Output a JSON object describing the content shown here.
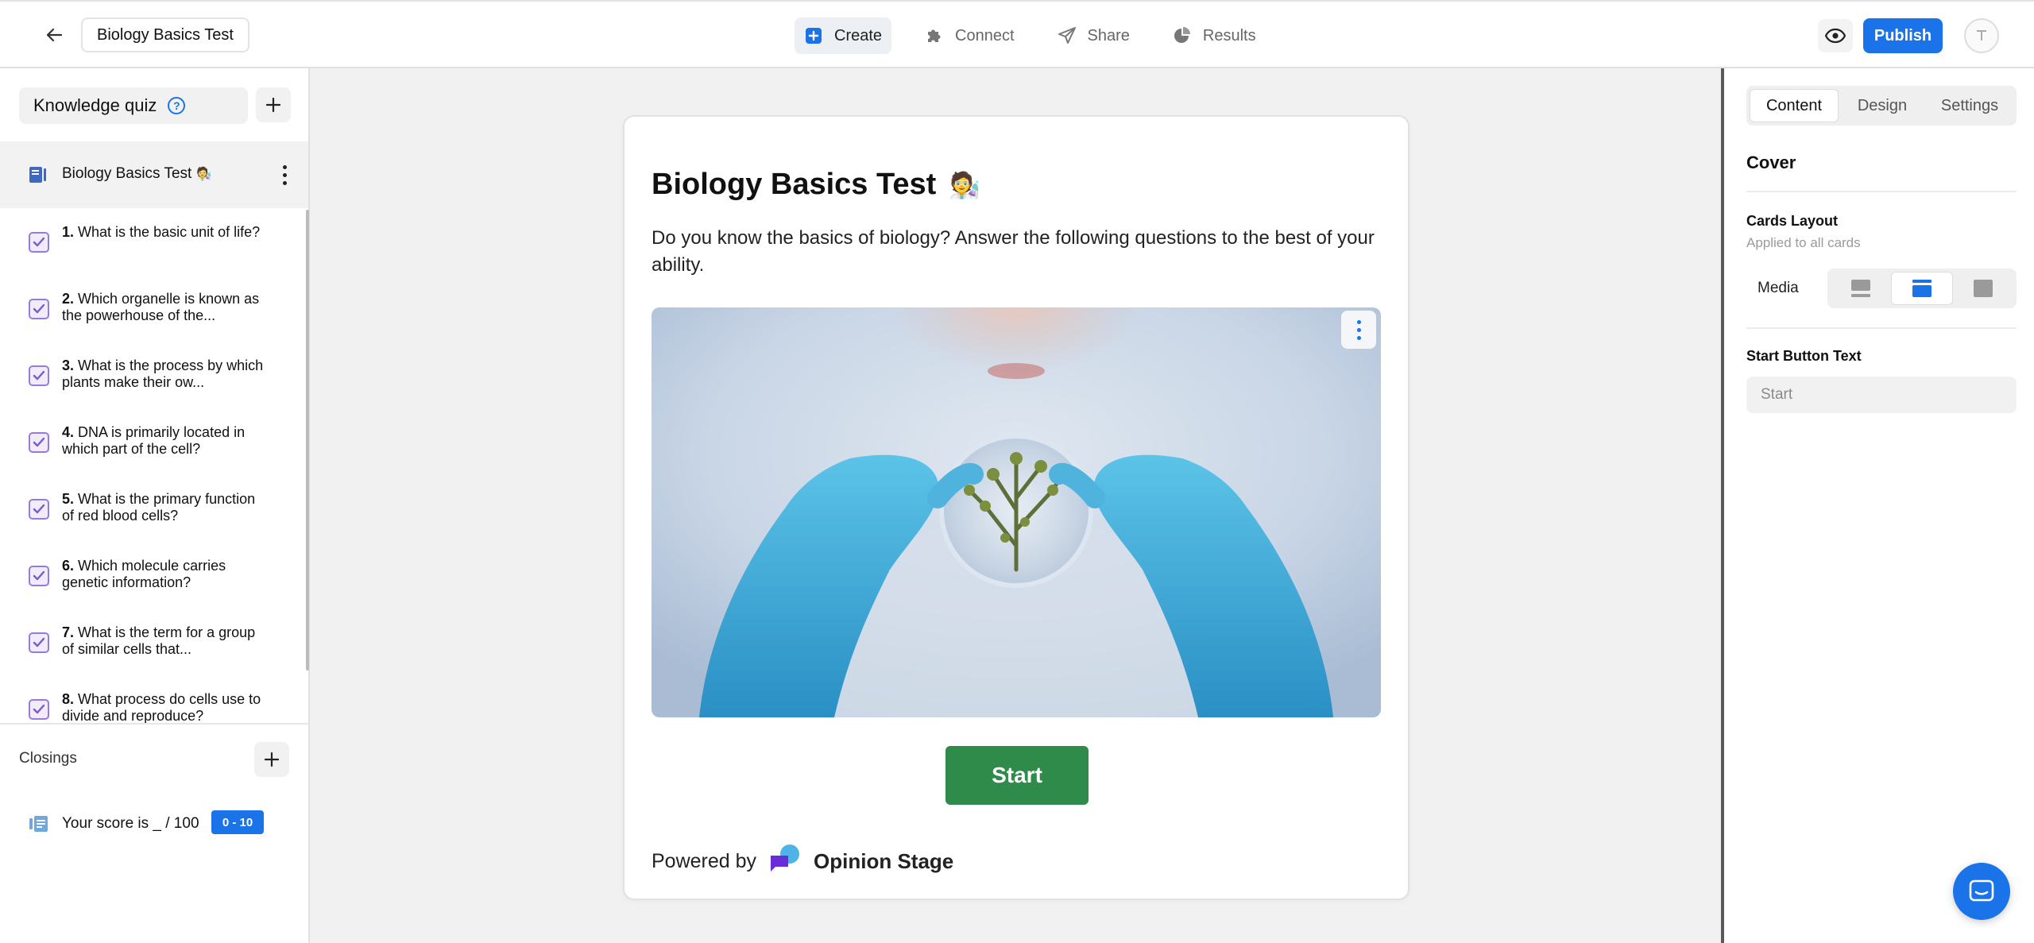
{
  "header": {
    "quiz_title": "Biology Basics Test",
    "nav": [
      {
        "label": "Create",
        "icon": "plus-square-icon",
        "active": true
      },
      {
        "label": "Connect",
        "icon": "puzzle-icon",
        "active": false
      },
      {
        "label": "Share",
        "icon": "send-icon",
        "active": false
      },
      {
        "label": "Results",
        "icon": "pie-chart-icon",
        "active": false
      }
    ],
    "publish_label": "Publish",
    "accent": "#1a73e8"
  },
  "sidebar": {
    "quiz_type": "Knowledge quiz",
    "cover_label": "Biology Basics Test",
    "questions": [
      {
        "num": "1.",
        "text": "What is the basic unit of life?"
      },
      {
        "num": "2.",
        "text": "Which organelle is known as the powerhouse of the..."
      },
      {
        "num": "3.",
        "text": "What is the process by which plants make their ow..."
      },
      {
        "num": "4.",
        "text": "DNA is primarily located in which part of the cell?"
      },
      {
        "num": "5.",
        "text": "What is the primary function of red blood cells?"
      },
      {
        "num": "6.",
        "text": "Which molecule carries genetic information?"
      },
      {
        "num": "7.",
        "text": "What is the term for a group of similar cells that..."
      },
      {
        "num": "8.",
        "text": "What process do cells use to divide and reproduce?"
      }
    ],
    "closings_label": "Closings",
    "closing": {
      "label": "Your score is _ / 100",
      "range": "0 - 10"
    }
  },
  "card": {
    "title": "Biology Basics Test",
    "title_emoji": "🧑‍🔬",
    "description": "Do you know the basics of biology? Answer the following questions to the best of your ability.",
    "start_label": "Start",
    "start_color": "#2e8b4a",
    "powered_by": "Powered by",
    "brand": "Opinion Stage"
  },
  "panel": {
    "tabs": [
      {
        "label": "Content",
        "active": true
      },
      {
        "label": "Design",
        "active": false
      },
      {
        "label": "Settings",
        "active": false
      }
    ],
    "cover_title": "Cover",
    "cards_layout": "Cards Layout",
    "applied_note": "Applied to all cards",
    "media_label": "Media",
    "start_button_text_label": "Start Button Text",
    "start_button_placeholder": "Start"
  }
}
